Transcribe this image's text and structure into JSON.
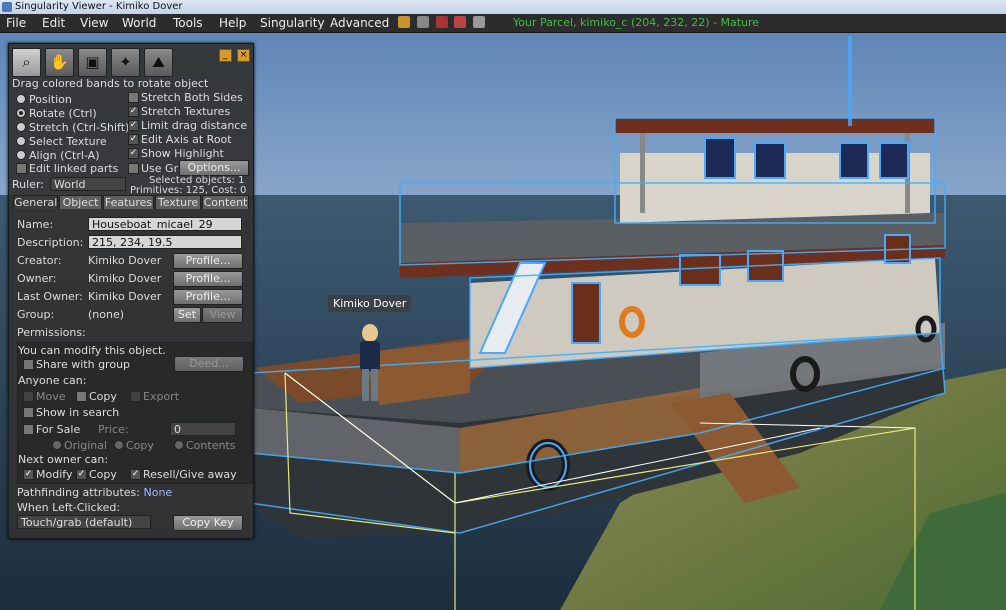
{
  "window": {
    "title": "Singularity Viewer - Kimiko Dover"
  },
  "menu": [
    "File",
    "Edit",
    "View",
    "World",
    "Tools",
    "Help",
    "Singularity",
    "Advanced"
  ],
  "status_icons": [
    "build-icon",
    "voice-icon",
    "no-fly-icon",
    "no-push-icon",
    "scripts-icon"
  ],
  "parcel": "Your Parcel, kimiko_c (204, 232, 22) - Mature",
  "colors": {
    "accent": "#d89a2a",
    "parcel_text": "#3fbf3f",
    "link": "#9fb9ff"
  },
  "scene": {
    "avatar_name": "Kimiko Dover"
  },
  "floater": {
    "tools": [
      "zoom-icon",
      "grab-icon",
      "edit-cube-icon",
      "create-wand-icon",
      "land-icon"
    ],
    "hint": "Drag colored bands to rotate object",
    "modes": [
      {
        "label": "Position",
        "selected": false
      },
      {
        "label": "Rotate (Ctrl)",
        "selected": true
      },
      {
        "label": "Stretch (Ctrl-Shift)",
        "selected": false
      },
      {
        "label": "Select Texture",
        "selected": false
      },
      {
        "label": "Align (Ctrl-A)",
        "selected": false
      }
    ],
    "edit_linked": "Edit linked parts",
    "options_right": [
      {
        "label": "Stretch Both Sides",
        "checked": false
      },
      {
        "label": "Stretch Textures",
        "checked": true
      },
      {
        "label": "Limit drag distance",
        "checked": true
      },
      {
        "label": "Edit Axis at Root",
        "checked": true
      },
      {
        "label": "Show Highlight",
        "checked": true
      },
      {
        "label": "Use Grid",
        "checked": false
      }
    ],
    "options_button": "Options...",
    "ruler_label": "Ruler:",
    "ruler_value": "World",
    "selected_objects": "Selected objects: 1",
    "primitives": "Primitives: 125, Cost: 0",
    "tabs": [
      "General",
      "Object",
      "Features",
      "Texture",
      "Content"
    ],
    "general": {
      "name_label": "Name:",
      "name_value": "Houseboat_micael_29",
      "desc_label": "Description:",
      "desc_value": "215, 234, 19.5",
      "creator_label": "Creator:",
      "creator_value": "Kimiko Dover",
      "owner_label": "Owner:",
      "owner_value": "Kimiko Dover",
      "last_owner_label": "Last Owner:",
      "last_owner_value": "Kimiko Dover",
      "profile_button": "Profile...",
      "group_label": "Group:",
      "group_value": "(none)",
      "set_button": "Set",
      "view_button": "View",
      "permissions_label": "Permissions:",
      "can_modify": "You can modify this object.",
      "share_group": "Share with group",
      "deed_button": "Deed...",
      "anyone_label": "Anyone can:",
      "move": "Move",
      "copy": "Copy",
      "export": "Export",
      "show_search": "Show in search",
      "for_sale": "For Sale",
      "price_label": "Price:",
      "price_value": "0",
      "original": "Original",
      "copy_opt": "Copy",
      "contents": "Contents",
      "next_owner_label": "Next owner can:",
      "modify": "Modify",
      "copy2": "Copy",
      "resell": "Resell/Give away",
      "pathfinding_label": "Pathfinding attributes:",
      "pathfinding_value": "None",
      "left_click_label": "When Left-Clicked:",
      "left_click_value": "Touch/grab (default)",
      "copy_key_button": "Copy Key"
    }
  }
}
